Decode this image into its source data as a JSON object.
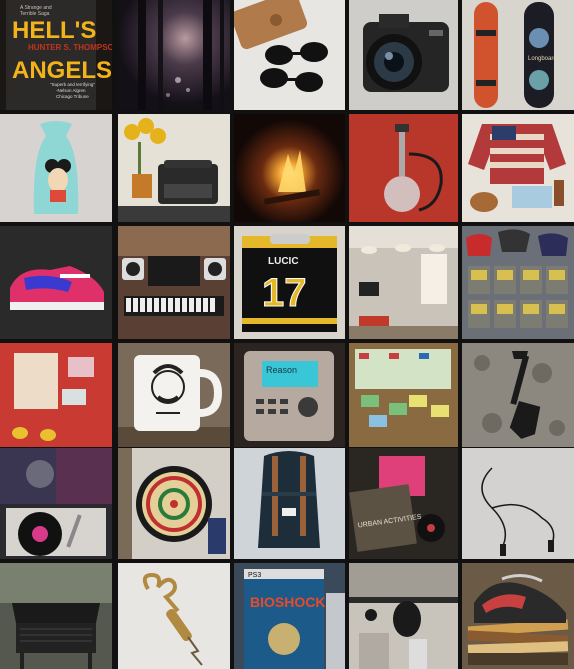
{
  "tiles": [
    {
      "id": "hells-angels-book",
      "subject": "book cover"
    },
    {
      "id": "dark-forest",
      "subject": "forest at night"
    },
    {
      "id": "wallet-sunglasses",
      "subject": "sunglasses and leather case"
    },
    {
      "id": "camera",
      "subject": "DSLR camera"
    },
    {
      "id": "skateboards",
      "subject": "skateboards"
    },
    {
      "id": "mickey-tank-top",
      "subject": "tank top"
    },
    {
      "id": "typewriter-sunflowers",
      "subject": "typewriter with sunflowers"
    },
    {
      "id": "campfire",
      "subject": "campfire"
    },
    {
      "id": "hookah",
      "subject": "hookah"
    },
    {
      "id": "flag-sweater",
      "subject": "stars and stripes sweater"
    },
    {
      "id": "pink-sneaker",
      "subject": "sneaker"
    },
    {
      "id": "studio-keyboard",
      "subject": "music studio"
    },
    {
      "id": "hockey-jersey",
      "subject": "hockey jersey"
    },
    {
      "id": "office-interior",
      "subject": "office"
    },
    {
      "id": "n64-games",
      "subject": "game cartridges"
    },
    {
      "id": "red-desk-cards",
      "subject": "red tabletop"
    },
    {
      "id": "mustache-mug",
      "subject": "mug"
    },
    {
      "id": "music-device",
      "subject": "audio device"
    },
    {
      "id": "monopoly",
      "subject": "board game"
    },
    {
      "id": "shovel",
      "subject": "shovel on leaves"
    },
    {
      "id": "vinyl-records",
      "subject": "turntable"
    },
    {
      "id": "dartboard",
      "subject": "dartboard"
    },
    {
      "id": "backpack",
      "subject": "backpack"
    },
    {
      "id": "record-albums",
      "subject": "albums"
    },
    {
      "id": "earbuds",
      "subject": "earphones"
    },
    {
      "id": "grill",
      "subject": "grill"
    },
    {
      "id": "corkscrew",
      "subject": "corkscrew"
    },
    {
      "id": "bioshock-game",
      "subject": "video game case"
    },
    {
      "id": "punching-bag",
      "subject": "speed bag"
    },
    {
      "id": "shoe-stack",
      "subject": "sneakers on magazines"
    }
  ],
  "text": {
    "book_small_top": "A Strange and",
    "book_small_2": "Terrible Saga",
    "book_title_1": "HELL'S",
    "book_author": "HUNTER S. THOMPSON",
    "book_title_2": "ANGELS",
    "book_blurb_1": "\"Superb and terrifying\"",
    "book_blurb_2": "-Nelson Algren",
    "book_blurb_3": "Chicago Tribune",
    "jersey_name": "LUCIC",
    "jersey_number": "17",
    "device_screen": "Reason",
    "game_title": "BIOSHOCK",
    "game_platform": "PS3",
    "album_text": "URBAN ACTIVITIES",
    "skate_text": "Longboard"
  },
  "colors": {
    "background": "#111111",
    "book_yellow": "#f2b41a",
    "book_red": "#c0341e",
    "sneaker_pink": "#e0306a",
    "sneaker_blue": "#3a3ad0",
    "jersey_gold": "#e5b82a",
    "device_screen": "#39c6d6"
  }
}
